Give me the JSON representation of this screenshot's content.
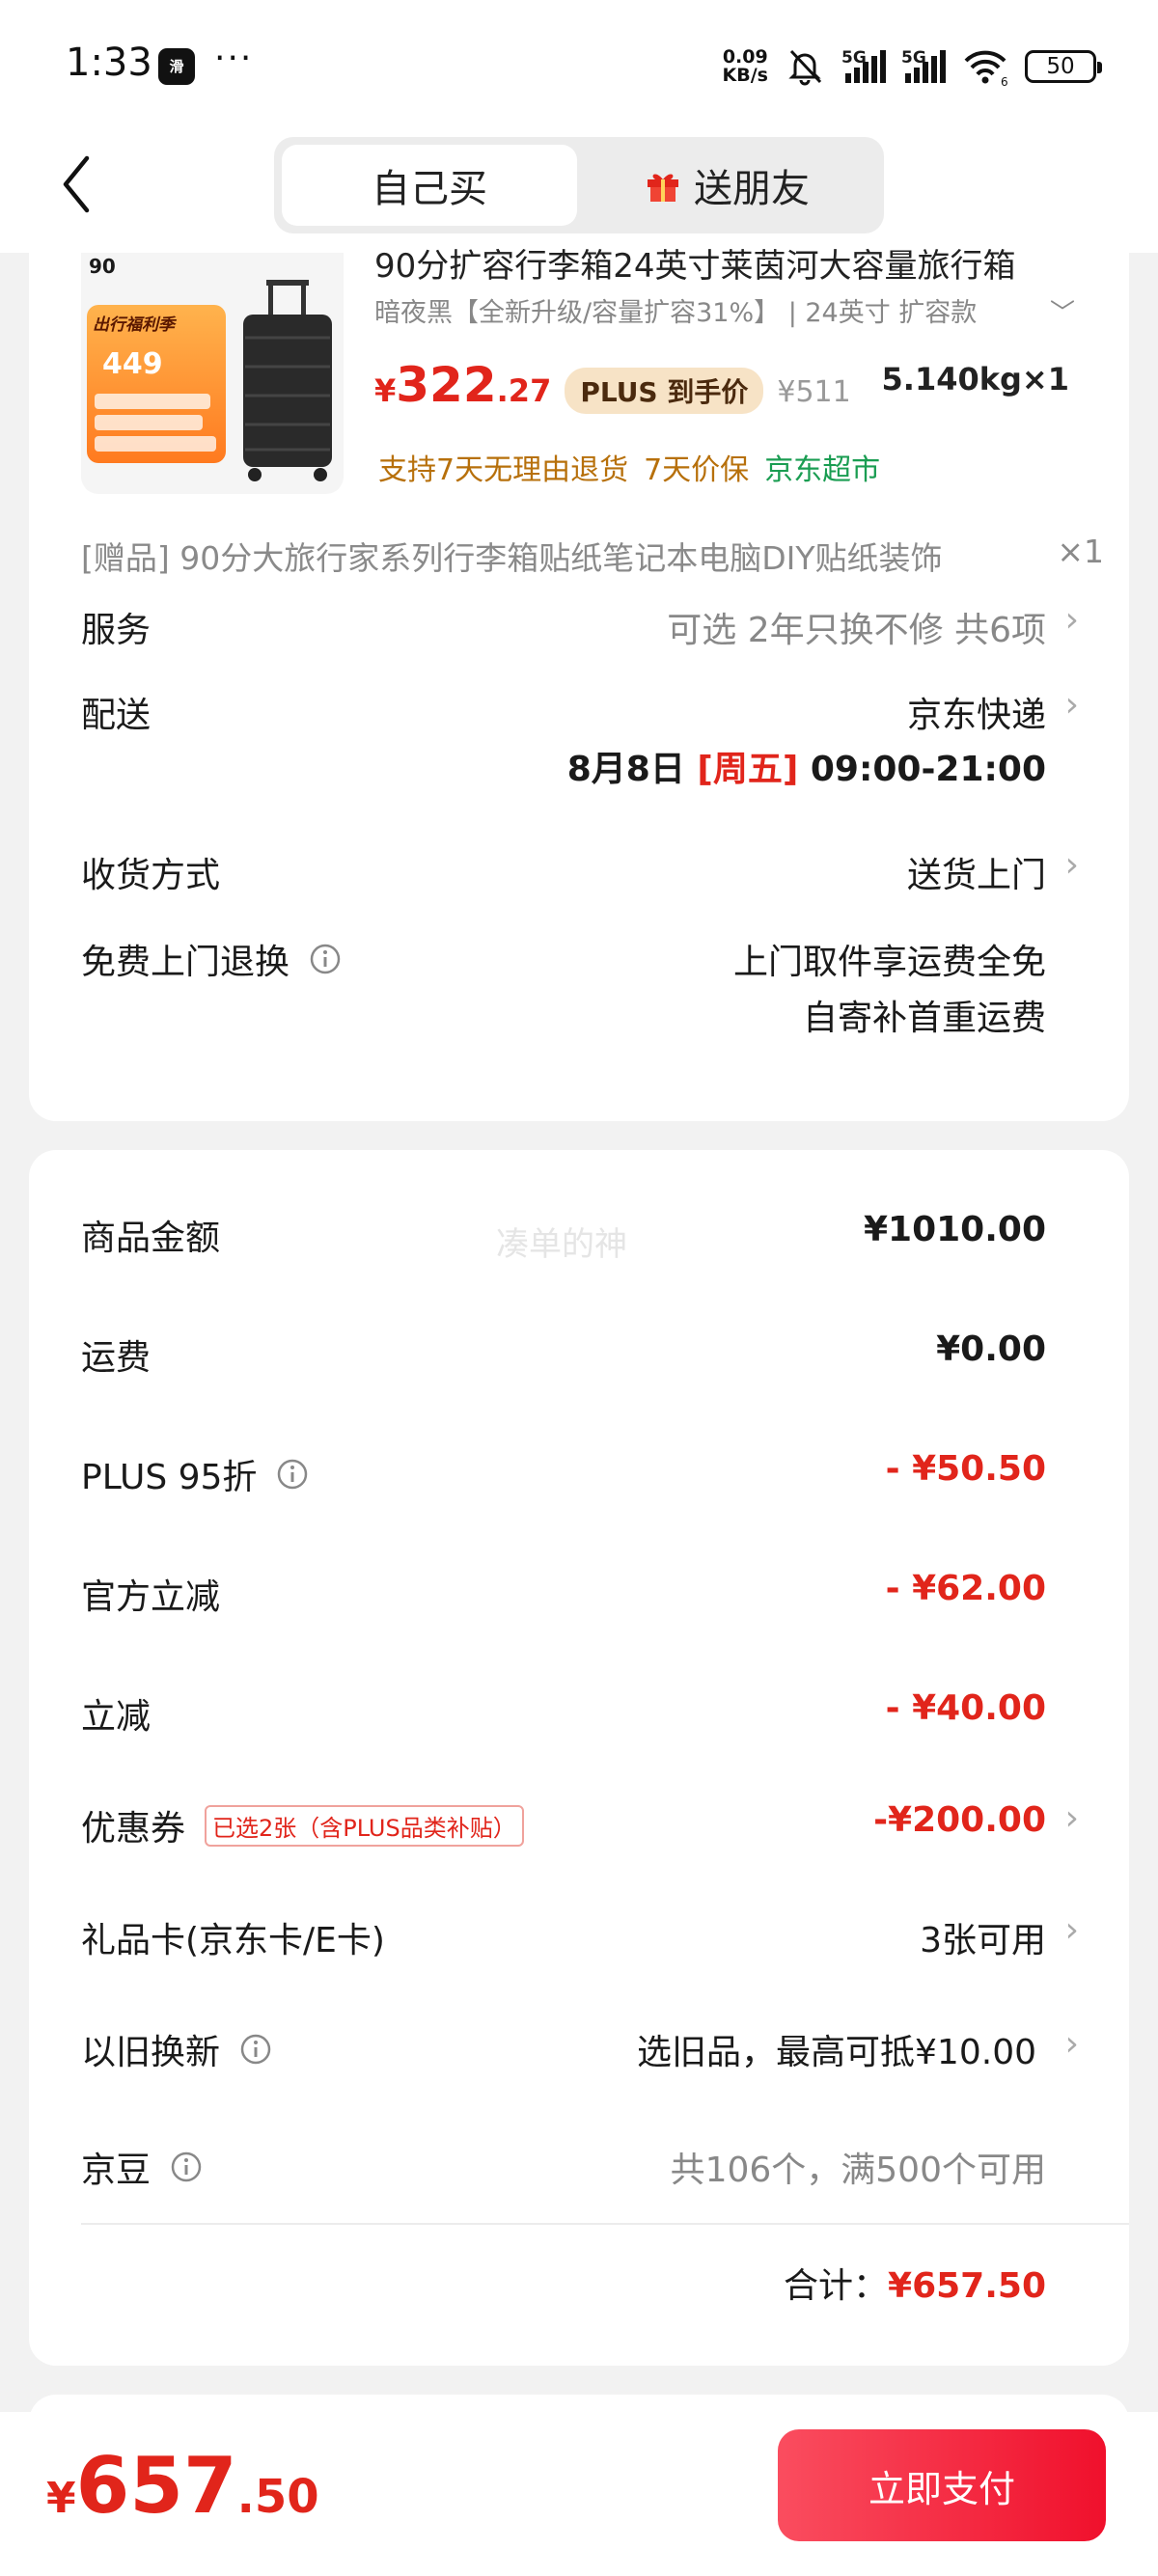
{
  "status_bar": {
    "time": "1:33",
    "app_icon_text": "滑",
    "dots": "···",
    "net_speed_value": "0.09",
    "net_speed_unit": "KB/s",
    "signal1": "5G",
    "signal2": "5G",
    "wifi_badge": "6",
    "battery": "50"
  },
  "header": {
    "tabs": [
      {
        "label": "自己买",
        "active": true
      },
      {
        "label": "送朋友",
        "active": false
      }
    ]
  },
  "product": {
    "brand_mark": "90",
    "promo_title": "出行福利季",
    "promo_price": "449",
    "title": "90分扩容行李箱24英寸莱茵河大容量旅行箱",
    "spec": "暗夜黑【全新升级/容量扩容31%】 | 24英寸 扩容款",
    "price_currency": "¥",
    "price_int": "322",
    "price_dec": ".27",
    "plus_label": "PLUS 到手价",
    "original_price": "¥511",
    "weight_qty": "5.140kg×1",
    "service_tags": [
      "支持7天无理由退货",
      "7天价保"
    ],
    "store_tag": "京东超市"
  },
  "gift": {
    "text": "[赠品] 90分大旅行家系列行李箱贴纸笔记本电脑DIY贴纸装饰",
    "qty": "×1"
  },
  "rows": {
    "service": {
      "label": "服务",
      "value": "可选 2年只换不修 共6项"
    },
    "delivery": {
      "label": "配送",
      "value": "京东快递",
      "date_prefix": "8月8日",
      "date_weekday": "[周五]",
      "date_time": "09:00-21:00"
    },
    "receive": {
      "label": "收货方式",
      "value": "送货上门"
    },
    "free_return": {
      "label": "免费上门退换",
      "value_line1": "上门取件享运费全免",
      "value_line2": "自寄补首重运费"
    }
  },
  "payment": {
    "watermark": "凑单的神",
    "goods_amount": {
      "label": "商品金额",
      "value": "¥1010.00"
    },
    "shipping": {
      "label": "运费",
      "value": "¥0.00"
    },
    "plus_discount": {
      "label": "PLUS 95折",
      "value": "- ¥50.50"
    },
    "official_cut": {
      "label": "官方立减",
      "value": "- ¥62.00"
    },
    "instant_cut": {
      "label": "立减",
      "value": "- ¥40.00"
    },
    "coupon": {
      "label": "优惠券",
      "badge": "已选2张（含PLUS品类补贴）",
      "value": "-¥200.00"
    },
    "gift_card": {
      "label": "礼品卡(京东卡/E卡)",
      "value": "3张可用"
    },
    "trade_in": {
      "label": "以旧换新",
      "value": "选旧品，最高可抵¥10.00"
    },
    "jd_beans": {
      "label": "京豆",
      "value": "共106个，满500个可用"
    },
    "total_label": "合计：",
    "total_value": "¥657.50"
  },
  "bottom": {
    "currency": "¥",
    "price_int": "657",
    "price_dec": ".50",
    "pay_button": "立即支付"
  },
  "colors": {
    "accent_red": "#e1251b",
    "plus_gold": "#f7e3c6",
    "service_orange": "#b7700b",
    "store_green": "#1a9d52"
  }
}
